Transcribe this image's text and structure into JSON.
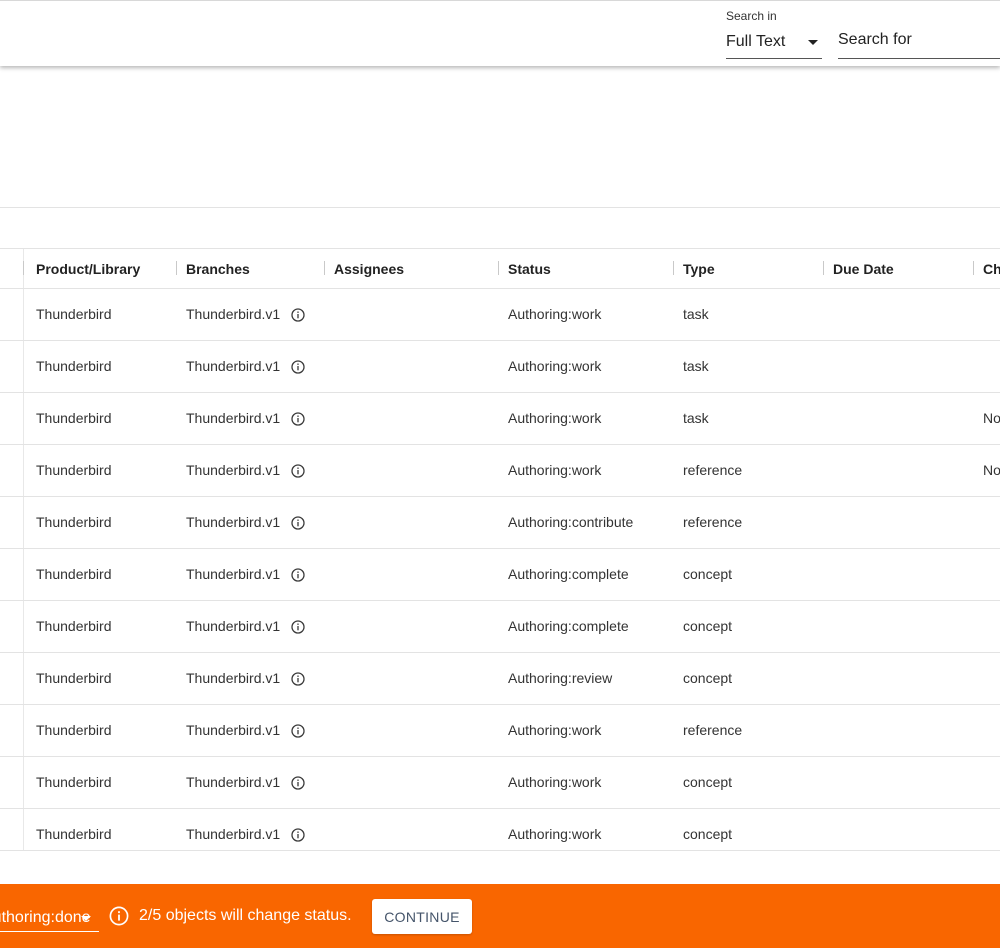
{
  "search": {
    "search_in_label": "Search in",
    "search_in_value": "Full Text",
    "search_for_placeholder": "Search for"
  },
  "table": {
    "columns": [
      {
        "label": "Product/Library"
      },
      {
        "label": "Branches"
      },
      {
        "label": "Assignees"
      },
      {
        "label": "Status"
      },
      {
        "label": "Type"
      },
      {
        "label": "Due Date"
      },
      {
        "label": "Ch"
      }
    ],
    "rows": [
      {
        "product": "Thunderbird",
        "branch": "Thunderbird.v1",
        "assignees": "",
        "status": "Authoring:work",
        "type": "task",
        "due_date": "",
        "ch": ""
      },
      {
        "product": "Thunderbird",
        "branch": "Thunderbird.v1",
        "assignees": "",
        "status": "Authoring:work",
        "type": "task",
        "due_date": "",
        "ch": ""
      },
      {
        "product": "Thunderbird",
        "branch": "Thunderbird.v1",
        "assignees": "",
        "status": "Authoring:work",
        "type": "task",
        "due_date": "",
        "ch": "No"
      },
      {
        "product": "Thunderbird",
        "branch": "Thunderbird.v1",
        "assignees": "",
        "status": "Authoring:work",
        "type": "reference",
        "due_date": "",
        "ch": "No"
      },
      {
        "product": "Thunderbird",
        "branch": "Thunderbird.v1",
        "assignees": "",
        "status": "Authoring:contribute",
        "type": "reference",
        "due_date": "",
        "ch": ""
      },
      {
        "product": "Thunderbird",
        "branch": "Thunderbird.v1",
        "assignees": "",
        "status": "Authoring:complete",
        "type": "concept",
        "due_date": "",
        "ch": ""
      },
      {
        "product": "Thunderbird",
        "branch": "Thunderbird.v1",
        "assignees": "",
        "status": "Authoring:complete",
        "type": "concept",
        "due_date": "",
        "ch": ""
      },
      {
        "product": "Thunderbird",
        "branch": "Thunderbird.v1",
        "assignees": "",
        "status": "Authoring:review",
        "type": "concept",
        "due_date": "",
        "ch": ""
      },
      {
        "product": "Thunderbird",
        "branch": "Thunderbird.v1",
        "assignees": "",
        "status": "Authoring:work",
        "type": "reference",
        "due_date": "",
        "ch": ""
      },
      {
        "product": "Thunderbird",
        "branch": "Thunderbird.v1",
        "assignees": "",
        "status": "Authoring:work",
        "type": "concept",
        "due_date": "",
        "ch": ""
      },
      {
        "product": "Thunderbird",
        "branch": "Thunderbird.v1",
        "assignees": "",
        "status": "Authoring:work",
        "type": "concept",
        "due_date": "",
        "ch": ""
      }
    ]
  },
  "bottom_bar": {
    "target_status": "Authoring:done",
    "message": "2/5 objects will change status.",
    "continue_label": "CONTINUE",
    "background_color": "#f96600"
  },
  "icons": {
    "branch_info": "info-circle-icon",
    "message_info": "info-circle-icon",
    "dropdown": "caret-down-icon"
  }
}
